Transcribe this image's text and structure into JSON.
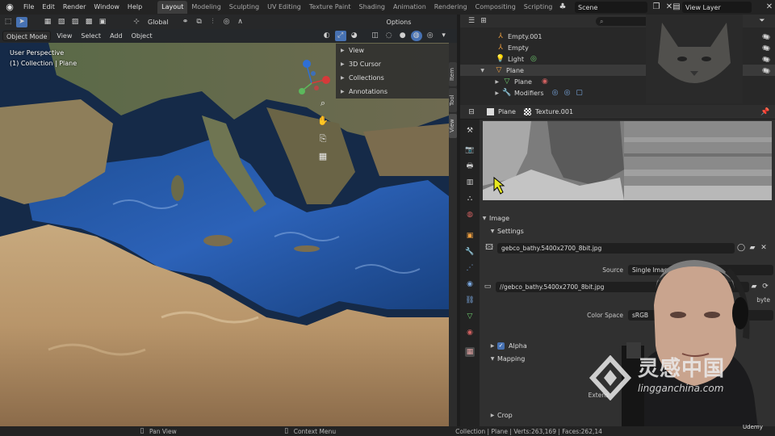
{
  "menu": [
    "File",
    "Edit",
    "Render",
    "Window",
    "Help"
  ],
  "workspaces": [
    "Layout",
    "Modeling",
    "Sculpting",
    "UV Editing",
    "Texture Paint",
    "Shading",
    "Animation",
    "Rendering",
    "Compositing",
    "Scripting"
  ],
  "active_workspace": "Layout",
  "scene": "Scene",
  "view_layer": "View Layer",
  "viewport": {
    "transform_orientation": "Global",
    "options_label": "Options",
    "mode": "Object Mode",
    "header_menus": [
      "View",
      "Select",
      "Add",
      "Object"
    ],
    "perspective_text": "User Perspective",
    "collection_text": "(1) Collection | Plane",
    "n_panel_sections": [
      "View",
      "3D Cursor",
      "Collections",
      "Annotations"
    ],
    "n_panel_tabs": [
      "Item",
      "Tool",
      "View"
    ]
  },
  "outliner": {
    "rows": [
      {
        "label": "Empty.001",
        "icon": "empty-icon"
      },
      {
        "label": "Empty",
        "icon": "empty-icon"
      },
      {
        "label": "Light",
        "icon": "light-icon"
      },
      {
        "label": "Plane",
        "icon": "mesh-object-icon"
      },
      {
        "label": "Plane",
        "icon": "mesh-data-icon"
      },
      {
        "label": "Modifiers",
        "icon": "wrench-icon"
      }
    ]
  },
  "properties": {
    "object": "Plane",
    "texture": "Texture.001",
    "sections": {
      "image": "Image",
      "settings": "Settings",
      "alpha": "Alpha",
      "mapping": "Mapping",
      "crop": "Crop"
    },
    "image_name": "gebco_bathy.5400x2700_8bit.jpg",
    "source_label": "Source",
    "source_value": "Single Image",
    "filepath": "//gebco_bathy.5400x2700_8bit.jpg",
    "color_space_label": "Color Space",
    "color_space_value": "sRGB",
    "byte_fragment": "byte",
    "extension_fragment": "Extens"
  },
  "statusbar": {
    "left_hint": "Pan View",
    "mid_hint": "Context Menu",
    "stats": "Collection | Plane | Verts:263,169 | Faces:262,14"
  },
  "watermark": {
    "text": "灵感中国",
    "url": "lingganchina.com"
  },
  "udemy": "Udemy",
  "colors": {
    "accent_blue": "#4772b3",
    "active_orange": "#f0a040",
    "object_green": "#6fcf6f"
  }
}
